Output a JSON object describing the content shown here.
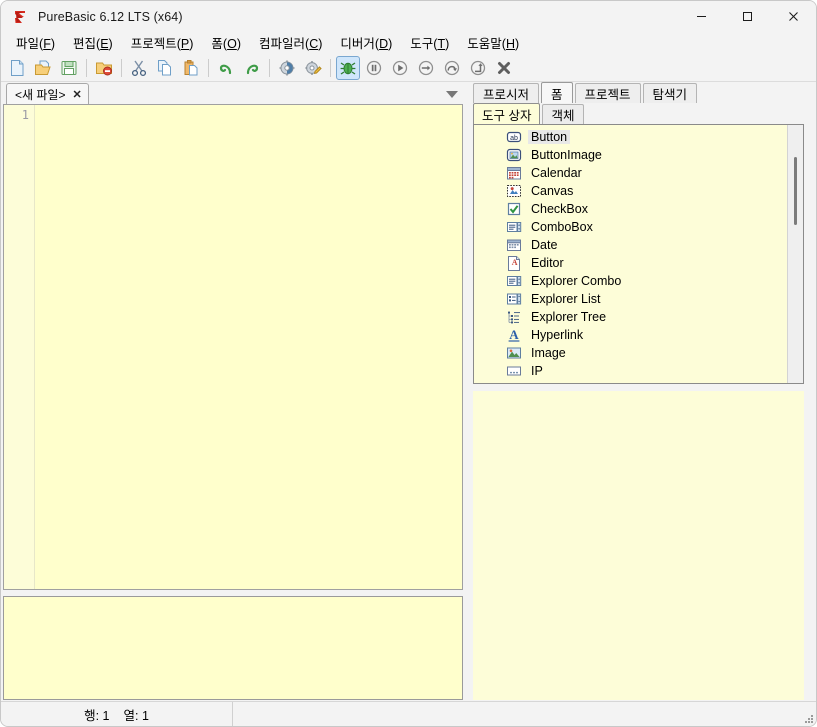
{
  "window": {
    "title": "PureBasic 6.12 LTS (x64)",
    "app_icon": "purebasic-logo-icon",
    "controls": [
      {
        "name": "minimize",
        "glyph": "—"
      },
      {
        "name": "maximize",
        "glyph": "□"
      },
      {
        "name": "close",
        "glyph": "✕"
      }
    ]
  },
  "menubar": {
    "items": [
      {
        "label": "파일",
        "accel": "F"
      },
      {
        "label": "편집",
        "accel": "E"
      },
      {
        "label": "프로젝트",
        "accel": "P"
      },
      {
        "label": "폼",
        "accel": "O"
      },
      {
        "label": "컴파일러",
        "accel": "C"
      },
      {
        "label": "디버거",
        "accel": "D"
      },
      {
        "label": "도구",
        "accel": "T"
      },
      {
        "label": "도움말",
        "accel": "H"
      }
    ]
  },
  "toolbar": {
    "buttons": [
      {
        "name": "new-file-button",
        "icon": "new-document-icon"
      },
      {
        "name": "open-file-button",
        "icon": "open-folder-icon"
      },
      {
        "name": "save-file-button",
        "icon": "floppy-save-icon"
      },
      {
        "sep": true
      },
      {
        "name": "close-file-button",
        "icon": "folder-close-icon"
      },
      {
        "sep": true
      },
      {
        "name": "cut-button",
        "icon": "scissors-icon"
      },
      {
        "name": "copy-button",
        "icon": "copy-pages-icon"
      },
      {
        "name": "paste-button",
        "icon": "clipboard-paste-icon"
      },
      {
        "sep": true
      },
      {
        "name": "undo-button",
        "icon": "undo-arrow-icon"
      },
      {
        "name": "redo-button",
        "icon": "redo-arrow-icon"
      },
      {
        "sep": true
      },
      {
        "name": "compile-button",
        "icon": "gear-blue-icon"
      },
      {
        "name": "compile-options-button",
        "icon": "gear-pencil-icon"
      },
      {
        "sep": true
      },
      {
        "name": "run-debug-button",
        "icon": "green-bug-icon",
        "active": true
      },
      {
        "name": "pause-button",
        "icon": "pause-circle-icon"
      },
      {
        "name": "continue-button",
        "icon": "play-circle-icon"
      },
      {
        "name": "step-button",
        "icon": "arrow-right-circle-icon"
      },
      {
        "name": "step-over-button",
        "icon": "arrow-loop-circle-icon"
      },
      {
        "name": "step-out-button",
        "icon": "arrow-out-circle-icon"
      },
      {
        "name": "stop-button",
        "icon": "stop-x-icon"
      }
    ]
  },
  "editor": {
    "tab": {
      "label": "<새 파일>",
      "close_glyph": "✕"
    },
    "tab_dropdown_icon": "chevron-down-icon",
    "line_numbers": [
      "1"
    ],
    "lines": [
      ""
    ]
  },
  "right_panel": {
    "tabs": [
      {
        "label": "프로시저",
        "selected": false
      },
      {
        "label": "폼",
        "selected": true
      },
      {
        "label": "프로젝트",
        "selected": false
      },
      {
        "label": "탐색기",
        "selected": false
      }
    ],
    "sub_tabs": [
      {
        "label": "도구 상자",
        "selected": true
      },
      {
        "label": "객체",
        "selected": false
      }
    ],
    "toolbox": {
      "items": [
        {
          "label": "Button",
          "icon": "button-ab-icon",
          "selected": true
        },
        {
          "label": "ButtonImage",
          "icon": "button-image-icon",
          "selected": false
        },
        {
          "label": "Calendar",
          "icon": "calendar-icon",
          "selected": false
        },
        {
          "label": "Canvas",
          "icon": "canvas-icon",
          "selected": false
        },
        {
          "label": "CheckBox",
          "icon": "checkbox-icon",
          "selected": false
        },
        {
          "label": "ComboBox",
          "icon": "combobox-icon",
          "selected": false
        },
        {
          "label": "Date",
          "icon": "date-icon",
          "selected": false
        },
        {
          "label": "Editor",
          "icon": "editor-icon",
          "selected": false
        },
        {
          "label": "Explorer Combo",
          "icon": "explorer-combo-icon",
          "selected": false
        },
        {
          "label": "Explorer List",
          "icon": "explorer-list-icon",
          "selected": false
        },
        {
          "label": "Explorer Tree",
          "icon": "explorer-tree-icon",
          "selected": false
        },
        {
          "label": "Hyperlink",
          "icon": "hyperlink-icon",
          "selected": false
        },
        {
          "label": "Image",
          "icon": "image-icon",
          "selected": false
        },
        {
          "label": "IP",
          "icon": "ip-icon",
          "selected": false
        }
      ]
    }
  },
  "statusbar": {
    "row_label": "행: 1",
    "col_label": "열: 1"
  },
  "colors": {
    "editor_background": "#ffffcc",
    "panel_background": "#fdfdd8",
    "chrome": "#f3f3f3",
    "accent_selected_tab": "#f7f7f7"
  }
}
